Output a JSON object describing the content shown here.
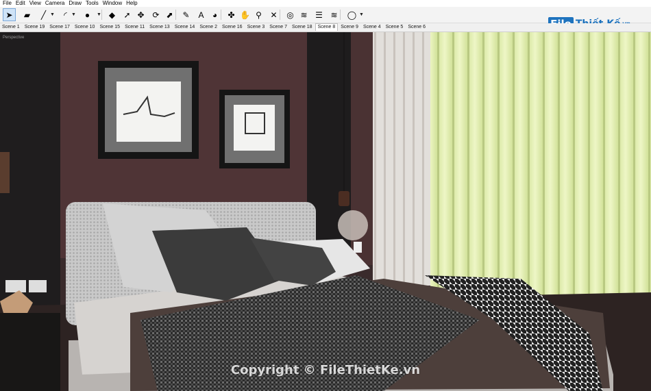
{
  "menu": [
    "File",
    "Edit",
    "View",
    "Camera",
    "Draw",
    "Tools",
    "Window",
    "Help"
  ],
  "toolbar": {
    "tools": [
      {
        "name": "select-icon",
        "glyph": "➤"
      },
      {
        "name": "eraser-icon",
        "glyph": "▰"
      },
      {
        "name": "line-icon",
        "glyph": "╱"
      },
      {
        "name": "arc-icon",
        "glyph": "◜"
      },
      {
        "name": "shape-icon",
        "glyph": "●"
      },
      {
        "name": "push-pull-icon",
        "glyph": "◆"
      },
      {
        "name": "follow-me-icon",
        "glyph": "➚"
      },
      {
        "name": "move-icon",
        "glyph": "✥"
      },
      {
        "name": "rotate-icon",
        "glyph": "⟳"
      },
      {
        "name": "scale-icon",
        "glyph": "⬈"
      },
      {
        "name": "tape-measure-icon",
        "glyph": "✎"
      },
      {
        "name": "text-icon",
        "glyph": "A"
      },
      {
        "name": "paint-bucket-icon",
        "glyph": "◕"
      },
      {
        "name": "orbit-icon",
        "glyph": "✤"
      },
      {
        "name": "pan-icon",
        "glyph": "✋"
      },
      {
        "name": "zoom-icon",
        "glyph": "⚲"
      },
      {
        "name": "zoom-extents-icon",
        "glyph": "✕"
      },
      {
        "name": "3d-warehouse-icon",
        "glyph": "◎"
      },
      {
        "name": "extension-warehouse-icon",
        "glyph": "≋"
      },
      {
        "name": "layout-icon",
        "glyph": "☰"
      },
      {
        "name": "extension-manager-icon",
        "glyph": "≋"
      },
      {
        "name": "account-icon",
        "glyph": "◯"
      }
    ]
  },
  "logo": {
    "box": "File",
    "text": "Thiết Kế",
    "suffix": ".vn"
  },
  "scenes": [
    "Scene 1",
    "Scene 19",
    "Scene 17",
    "Scene 10",
    "Scene 15",
    "Scene 11",
    "Scene 13",
    "Scene 14",
    "Scene 2",
    "Scene 16",
    "Scene 3",
    "Scene 7",
    "Scene 18",
    "Scene 8",
    "Scene 9",
    "Scene 4",
    "Scene 5",
    "Scene 6"
  ],
  "active_scene": "Scene 8",
  "viewport": {
    "camera_label": "Perspective"
  },
  "watermark": "Copyright © FileThietKe.vn",
  "colors": {
    "accent": "#1e73be",
    "wall": "#4f3436",
    "curtain": "#e4f0b6"
  }
}
